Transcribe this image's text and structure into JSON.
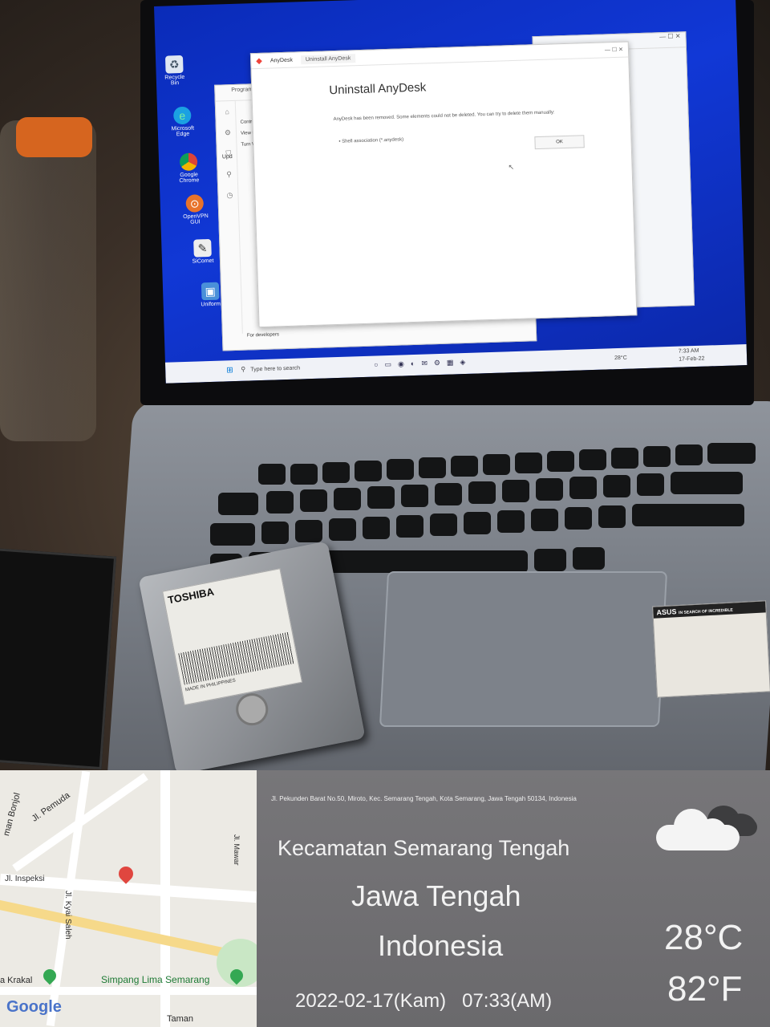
{
  "screen": {
    "desktop_icons": [
      {
        "label": "Recycle Bin",
        "icon": "recycle-bin-icon"
      },
      {
        "label": "Microsoft Edge",
        "icon": "edge-icon"
      },
      {
        "label": "Google Chrome",
        "icon": "chrome-icon"
      },
      {
        "label": "OpenVPN GUI",
        "icon": "openvpn-icon"
      },
      {
        "label": "SiComet",
        "icon": "app-icon"
      },
      {
        "label": "Uniform",
        "icon": "monitor-icon"
      }
    ],
    "control_panel": {
      "title": "Programs and",
      "side_items": [
        "Control Panel",
        "View installed",
        "Turn Windows off"
      ],
      "footer": "For developers",
      "update_label": "Upd"
    },
    "anydesk": {
      "tab_app": "AnyDesk",
      "tab_dialog": "Uninstall AnyDesk",
      "heading": "Uninstall AnyDesk",
      "message": "AnyDesk has been removed. Some elements could not be deleted. You can try to delete them manually:",
      "item": "• Shell association (*.anydesk)",
      "ok": "OK"
    },
    "taskbar": {
      "search_placeholder": "Type here to search",
      "temp": "28°C",
      "time": "7:33 AM",
      "date": "17-Feb-22"
    }
  },
  "hdd": {
    "brand": "TOSHIBA",
    "made_in": "MADE IN PHILIPPINES"
  },
  "laptop": {
    "sticker_brand": "ASUS",
    "sticker_text": "IN SEARCH OF INCREDIBLE"
  },
  "map": {
    "labels": {
      "road_bonjol": "man Bonjol",
      "pemuda": "Jl. Pemuda",
      "inspeksi": "Jl. Inspeksi",
      "mawar": "Jl. Mawar",
      "kyai_saleh": "Jl. Kyai Saleh",
      "krakal": "a Krakal",
      "simpang_lima": "Simpang Lima Semarang",
      "taman": "Taman",
      "google": "Google"
    },
    "colors": {
      "pin": "#e0463f",
      "park": "#34a853"
    }
  },
  "info": {
    "address": "Jl. Pekunden Barat No.50, Miroto, Kec. Semarang Tengah, Kota Semarang, Jawa Tengah 50134, Indonesia",
    "district": "Kecamatan Semarang Tengah",
    "province": "Jawa Tengah",
    "country": "Indonesia",
    "datetime": "2022-02-17(Kam)   07:33(AM)",
    "temp_c": "28°C",
    "temp_f": "82°F",
    "weather_icon": "cloudy-icon"
  }
}
